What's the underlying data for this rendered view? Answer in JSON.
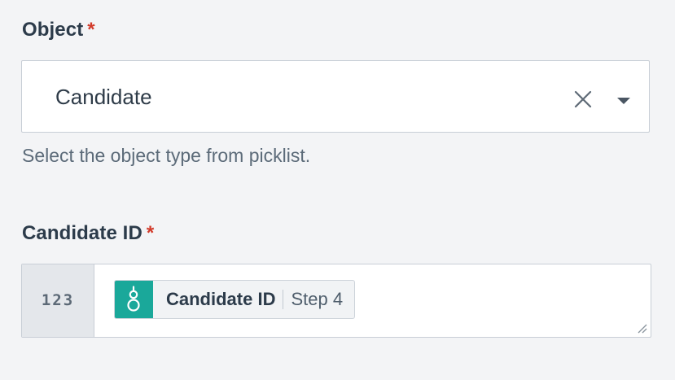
{
  "object_field": {
    "label": "Object",
    "required_mark": "*",
    "value": "Candidate",
    "hint": "Select the object type from picklist."
  },
  "candidate_id_field": {
    "label": "Candidate ID",
    "required_mark": "*",
    "type_badge": "123",
    "datapill": {
      "label": "Candidate ID",
      "step": "Step 4",
      "icon": "greenhouse-icon",
      "icon_color": "#1aa89a"
    }
  },
  "icons": {
    "clear": "close-icon",
    "dropdown": "caret-down-icon",
    "resize": "resize-handle-icon"
  }
}
